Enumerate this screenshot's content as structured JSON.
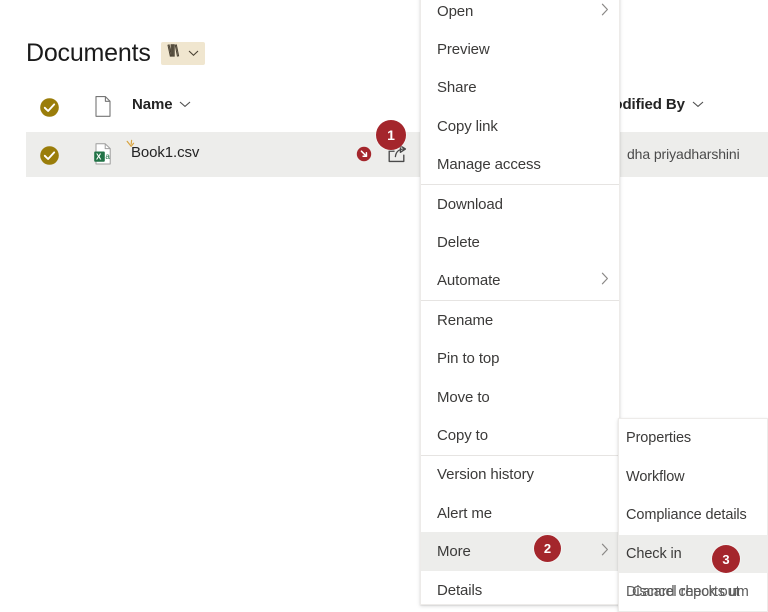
{
  "header": {
    "title": "Documents",
    "library_icon": "books-icon",
    "chevron_icon": "chevron-down-icon"
  },
  "list": {
    "columns": [
      {
        "key": "select",
        "label": "",
        "icon": "check-circle-icon"
      },
      {
        "key": "filetype",
        "label": "",
        "icon": "file-icon"
      },
      {
        "key": "name",
        "label": "Name",
        "icon": "chevron-down-icon"
      },
      {
        "key": "modby",
        "label": "Modified By",
        "icon": "chevron-down-icon"
      }
    ],
    "rows": [
      {
        "selected": true,
        "select_icon": "check-circle-icon",
        "file_icon": "excel-csv-icon",
        "name": "Book1.csv",
        "new_marker_icon": "sparkle-icon",
        "checked_out_icon": "checked-out-icon",
        "share_icon": "share-icon",
        "more_icon": "ellipsis-icon",
        "modified_by": "dha priyadharshini"
      }
    ]
  },
  "context_menu": {
    "items": [
      {
        "label": "Open",
        "submenu": true,
        "divider_after": false
      },
      {
        "label": "Preview",
        "submenu": false,
        "divider_after": false
      },
      {
        "label": "Share",
        "submenu": false,
        "divider_after": false
      },
      {
        "label": "Copy link",
        "submenu": false,
        "divider_after": false
      },
      {
        "label": "Manage access",
        "submenu": false,
        "divider_after": true
      },
      {
        "label": "Download",
        "submenu": false,
        "divider_after": false
      },
      {
        "label": "Delete",
        "submenu": false,
        "divider_after": false
      },
      {
        "label": "Automate",
        "submenu": true,
        "divider_after": true
      },
      {
        "label": "Rename",
        "submenu": false,
        "divider_after": false
      },
      {
        "label": "Pin to top",
        "submenu": false,
        "divider_after": false
      },
      {
        "label": "Move to",
        "submenu": false,
        "divider_after": false
      },
      {
        "label": "Copy to",
        "submenu": false,
        "divider_after": true
      },
      {
        "label": "Version history",
        "submenu": false,
        "divider_after": false
      },
      {
        "label": "Alert me",
        "submenu": false,
        "divider_after": false
      },
      {
        "label": "More",
        "submenu": true,
        "divider_after": false,
        "selected": true
      },
      {
        "label": "Details",
        "submenu": false,
        "divider_after": false
      }
    ]
  },
  "sub_menu": {
    "items": [
      {
        "label": "Properties",
        "selected": false
      },
      {
        "label": "Workflow",
        "selected": false
      },
      {
        "label": "Compliance details",
        "selected": false
      },
      {
        "label": "Check in",
        "selected": true
      }
    ],
    "last_item": {
      "label_a": "Discard check out",
      "label_b": "Cancel reports um"
    }
  },
  "badges": [
    {
      "id": 1,
      "text": "1"
    },
    {
      "id": 2,
      "text": "2"
    },
    {
      "id": 3,
      "text": "3"
    }
  ],
  "colors": {
    "badge_red": "#a4262c",
    "selection_gold": "#9a7d0a",
    "row_selected_bg": "#ededeb",
    "library_pill_bg": "#f0e6cf",
    "excel_green": "#217346",
    "menu_text": "#3b3a39"
  }
}
